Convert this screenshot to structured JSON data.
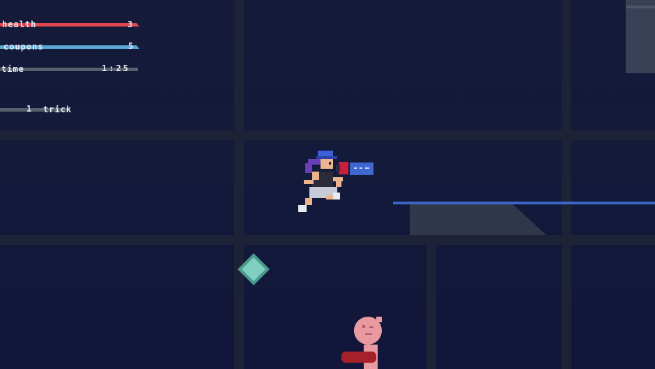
{
  "hud": {
    "health": {
      "label": "health",
      "value": "3",
      "color": "#e0484e"
    },
    "coupons": {
      "label": "coupons",
      "value": "5",
      "color": "#5aa8d8"
    },
    "time": {
      "label": "time",
      "value": "1:25",
      "color": "#5a5f6e"
    },
    "trick": {
      "count": "1",
      "label": "trick",
      "color": "#5a5f6e"
    }
  },
  "player": {
    "hair_color": "#3e5fd8",
    "accent": "#c8203a"
  },
  "pickup": {
    "icon": "diamond-gem",
    "color": "#7fd0c0"
  },
  "enemy": {
    "icon": "pink-round-head-creature",
    "color": "#e89aa0"
  }
}
